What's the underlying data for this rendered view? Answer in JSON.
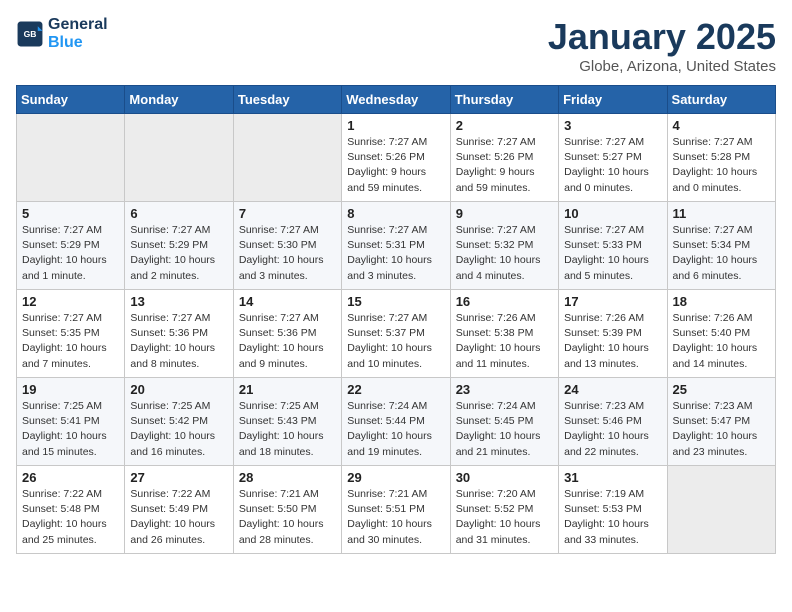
{
  "logo": {
    "line1": "General",
    "line2": "Blue"
  },
  "title": "January 2025",
  "subtitle": "Globe, Arizona, United States",
  "header_days": [
    "Sunday",
    "Monday",
    "Tuesday",
    "Wednesday",
    "Thursday",
    "Friday",
    "Saturday"
  ],
  "weeks": [
    [
      {
        "day": "",
        "info": ""
      },
      {
        "day": "",
        "info": ""
      },
      {
        "day": "",
        "info": ""
      },
      {
        "day": "1",
        "info": "Sunrise: 7:27 AM\nSunset: 5:26 PM\nDaylight: 9 hours\nand 59 minutes."
      },
      {
        "day": "2",
        "info": "Sunrise: 7:27 AM\nSunset: 5:26 PM\nDaylight: 9 hours\nand 59 minutes."
      },
      {
        "day": "3",
        "info": "Sunrise: 7:27 AM\nSunset: 5:27 PM\nDaylight: 10 hours\nand 0 minutes."
      },
      {
        "day": "4",
        "info": "Sunrise: 7:27 AM\nSunset: 5:28 PM\nDaylight: 10 hours\nand 0 minutes."
      }
    ],
    [
      {
        "day": "5",
        "info": "Sunrise: 7:27 AM\nSunset: 5:29 PM\nDaylight: 10 hours\nand 1 minute."
      },
      {
        "day": "6",
        "info": "Sunrise: 7:27 AM\nSunset: 5:29 PM\nDaylight: 10 hours\nand 2 minutes."
      },
      {
        "day": "7",
        "info": "Sunrise: 7:27 AM\nSunset: 5:30 PM\nDaylight: 10 hours\nand 3 minutes."
      },
      {
        "day": "8",
        "info": "Sunrise: 7:27 AM\nSunset: 5:31 PM\nDaylight: 10 hours\nand 3 minutes."
      },
      {
        "day": "9",
        "info": "Sunrise: 7:27 AM\nSunset: 5:32 PM\nDaylight: 10 hours\nand 4 minutes."
      },
      {
        "day": "10",
        "info": "Sunrise: 7:27 AM\nSunset: 5:33 PM\nDaylight: 10 hours\nand 5 minutes."
      },
      {
        "day": "11",
        "info": "Sunrise: 7:27 AM\nSunset: 5:34 PM\nDaylight: 10 hours\nand 6 minutes."
      }
    ],
    [
      {
        "day": "12",
        "info": "Sunrise: 7:27 AM\nSunset: 5:35 PM\nDaylight: 10 hours\nand 7 minutes."
      },
      {
        "day": "13",
        "info": "Sunrise: 7:27 AM\nSunset: 5:36 PM\nDaylight: 10 hours\nand 8 minutes."
      },
      {
        "day": "14",
        "info": "Sunrise: 7:27 AM\nSunset: 5:36 PM\nDaylight: 10 hours\nand 9 minutes."
      },
      {
        "day": "15",
        "info": "Sunrise: 7:27 AM\nSunset: 5:37 PM\nDaylight: 10 hours\nand 10 minutes."
      },
      {
        "day": "16",
        "info": "Sunrise: 7:26 AM\nSunset: 5:38 PM\nDaylight: 10 hours\nand 11 minutes."
      },
      {
        "day": "17",
        "info": "Sunrise: 7:26 AM\nSunset: 5:39 PM\nDaylight: 10 hours\nand 13 minutes."
      },
      {
        "day": "18",
        "info": "Sunrise: 7:26 AM\nSunset: 5:40 PM\nDaylight: 10 hours\nand 14 minutes."
      }
    ],
    [
      {
        "day": "19",
        "info": "Sunrise: 7:25 AM\nSunset: 5:41 PM\nDaylight: 10 hours\nand 15 minutes."
      },
      {
        "day": "20",
        "info": "Sunrise: 7:25 AM\nSunset: 5:42 PM\nDaylight: 10 hours\nand 16 minutes."
      },
      {
        "day": "21",
        "info": "Sunrise: 7:25 AM\nSunset: 5:43 PM\nDaylight: 10 hours\nand 18 minutes."
      },
      {
        "day": "22",
        "info": "Sunrise: 7:24 AM\nSunset: 5:44 PM\nDaylight: 10 hours\nand 19 minutes."
      },
      {
        "day": "23",
        "info": "Sunrise: 7:24 AM\nSunset: 5:45 PM\nDaylight: 10 hours\nand 21 minutes."
      },
      {
        "day": "24",
        "info": "Sunrise: 7:23 AM\nSunset: 5:46 PM\nDaylight: 10 hours\nand 22 minutes."
      },
      {
        "day": "25",
        "info": "Sunrise: 7:23 AM\nSunset: 5:47 PM\nDaylight: 10 hours\nand 23 minutes."
      }
    ],
    [
      {
        "day": "26",
        "info": "Sunrise: 7:22 AM\nSunset: 5:48 PM\nDaylight: 10 hours\nand 25 minutes."
      },
      {
        "day": "27",
        "info": "Sunrise: 7:22 AM\nSunset: 5:49 PM\nDaylight: 10 hours\nand 26 minutes."
      },
      {
        "day": "28",
        "info": "Sunrise: 7:21 AM\nSunset: 5:50 PM\nDaylight: 10 hours\nand 28 minutes."
      },
      {
        "day": "29",
        "info": "Sunrise: 7:21 AM\nSunset: 5:51 PM\nDaylight: 10 hours\nand 30 minutes."
      },
      {
        "day": "30",
        "info": "Sunrise: 7:20 AM\nSunset: 5:52 PM\nDaylight: 10 hours\nand 31 minutes."
      },
      {
        "day": "31",
        "info": "Sunrise: 7:19 AM\nSunset: 5:53 PM\nDaylight: 10 hours\nand 33 minutes."
      },
      {
        "day": "",
        "info": ""
      }
    ]
  ]
}
